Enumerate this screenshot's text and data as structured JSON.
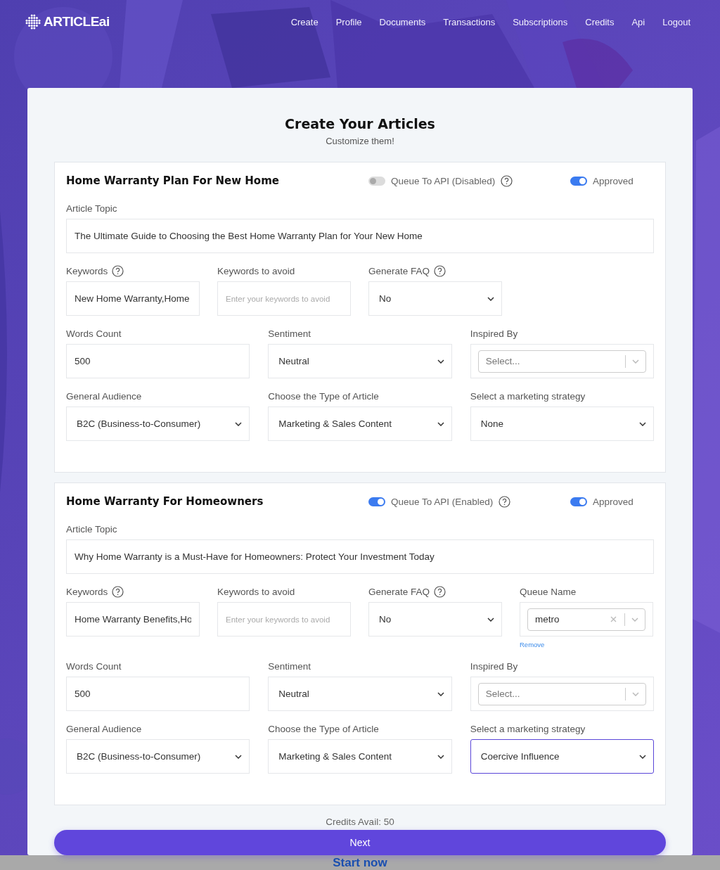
{
  "brand": "ARTICLEai",
  "nav": [
    "Create",
    "Profile",
    "Documents",
    "Transactions",
    "Subscriptions",
    "Credits",
    "Api",
    "Logout"
  ],
  "heading": {
    "title": "Create Your Articles",
    "subtitle": "Customize them!"
  },
  "sections": [
    {
      "title": "Home Warranty Plan For New Home",
      "queue_api": {
        "label": "Queue To API (Disabled)",
        "on": false
      },
      "approved": {
        "label": "Approved",
        "on": true
      },
      "rows": [
        [
          {
            "kind": "text",
            "label": "Article Topic",
            "help": false,
            "value": "The Ultimate Guide to Choosing the Best Home Warranty Plan for Your New Home"
          }
        ],
        [
          {
            "kind": "text",
            "label": "Keywords",
            "help": true,
            "value": "New Home Warranty,Home"
          },
          {
            "kind": "text",
            "label": "Keywords to avoid",
            "help": false,
            "placeholder": "Enter your keywords to avoid"
          },
          {
            "kind": "select",
            "label": "Generate FAQ",
            "help": true,
            "value": "No",
            "focused": false
          }
        ],
        [
          {
            "kind": "text",
            "label": "Words Count",
            "help": false,
            "value": "500"
          },
          {
            "kind": "select",
            "label": "Sentiment",
            "help": false,
            "value": "Neutral",
            "focused": false
          },
          {
            "kind": "combo",
            "label": "Inspired By",
            "help": false,
            "placeholder": "Select..."
          }
        ],
        [
          {
            "kind": "select",
            "label": "General Audience",
            "help": false,
            "value": "B2C (Business-to-Consumer)",
            "focused": false
          },
          {
            "kind": "select",
            "label": "Choose the Type of Article",
            "help": false,
            "value": "Marketing & Sales Content",
            "focused": false
          },
          {
            "kind": "select",
            "label": "Select a marketing strategy",
            "help": false,
            "value": "None",
            "focused": false
          }
        ]
      ]
    },
    {
      "title": "Home Warranty For Homeowners",
      "queue_api": {
        "label": "Queue To API (Enabled)",
        "on": true
      },
      "approved": {
        "label": "Approved",
        "on": true
      },
      "rows": [
        [
          {
            "kind": "text",
            "label": "Article Topic",
            "help": false,
            "value": "Why Home Warranty is a Must-Have for Homeowners: Protect Your Investment Today"
          }
        ],
        [
          {
            "kind": "text",
            "label": "Keywords",
            "help": true,
            "value": "Home Warranty Benefits,Ho"
          },
          {
            "kind": "text",
            "label": "Keywords to avoid",
            "help": false,
            "placeholder": "Enter your keywords to avoid"
          },
          {
            "kind": "select",
            "label": "Generate FAQ",
            "help": true,
            "value": "No",
            "focused": false
          },
          {
            "kind": "combo",
            "label": "Queue Name",
            "help": false,
            "value": "metro",
            "link": "Remove"
          }
        ],
        [
          {
            "kind": "text",
            "label": "Words Count",
            "help": false,
            "value": "500"
          },
          {
            "kind": "select",
            "label": "Sentiment",
            "help": false,
            "value": "Neutral",
            "focused": false
          },
          {
            "kind": "combo",
            "label": "Inspired By",
            "help": false,
            "placeholder": "Select..."
          }
        ],
        [
          {
            "kind": "select",
            "label": "General Audience",
            "help": false,
            "value": "B2C (Business-to-Consumer)",
            "focused": false
          },
          {
            "kind": "select",
            "label": "Choose the Type of Article",
            "help": false,
            "value": "Marketing & Sales Content",
            "focused": false
          },
          {
            "kind": "select",
            "label": "Select a marketing strategy",
            "help": false,
            "value": "Coercive Influence",
            "focused": true
          }
        ]
      ]
    }
  ],
  "credits": "Credits Avail: 50",
  "next_button": "Next",
  "footer_link": "Start now"
}
